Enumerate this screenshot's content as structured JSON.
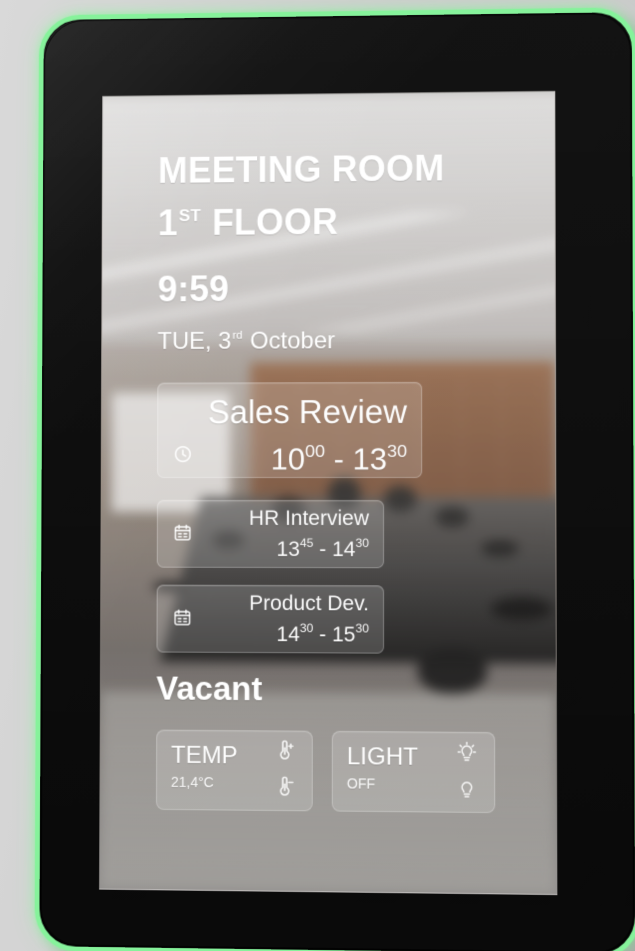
{
  "device": {
    "room_title_line_1": "MEETING ROOM",
    "room_title_line_2_prefix": "1",
    "room_title_line_2_super": "ST",
    "room_title_line_2_suffix": " FLOOR",
    "time": "9:59",
    "date_prefix": "TUE, 3",
    "date_super": "rd",
    "date_suffix": " October",
    "status": "Vacant",
    "accent_color": "#86f29b"
  },
  "meetings": [
    {
      "title": "Sales Review",
      "start_base": "10",
      "start_super": "00",
      "end_base": "13",
      "end_super": "30",
      "icon": "clock-icon"
    },
    {
      "title": "HR Interview",
      "start_base": "13",
      "start_super": "45",
      "end_base": "14",
      "end_super": "30",
      "icon": "calendar-icon"
    },
    {
      "title": "Product Dev.",
      "start_base": "14",
      "start_super": "30",
      "end_base": "15",
      "end_super": "30",
      "icon": "calendar-icon"
    }
  ],
  "controls": {
    "temp": {
      "label": "TEMP",
      "value": "21,4°C",
      "top_icon": "thermometer-plus-icon",
      "bottom_icon": "thermometer-minus-icon"
    },
    "light": {
      "label": "LIGHT",
      "value": "OFF",
      "top_icon": "bulb-on-icon",
      "bottom_icon": "bulb-icon"
    }
  }
}
